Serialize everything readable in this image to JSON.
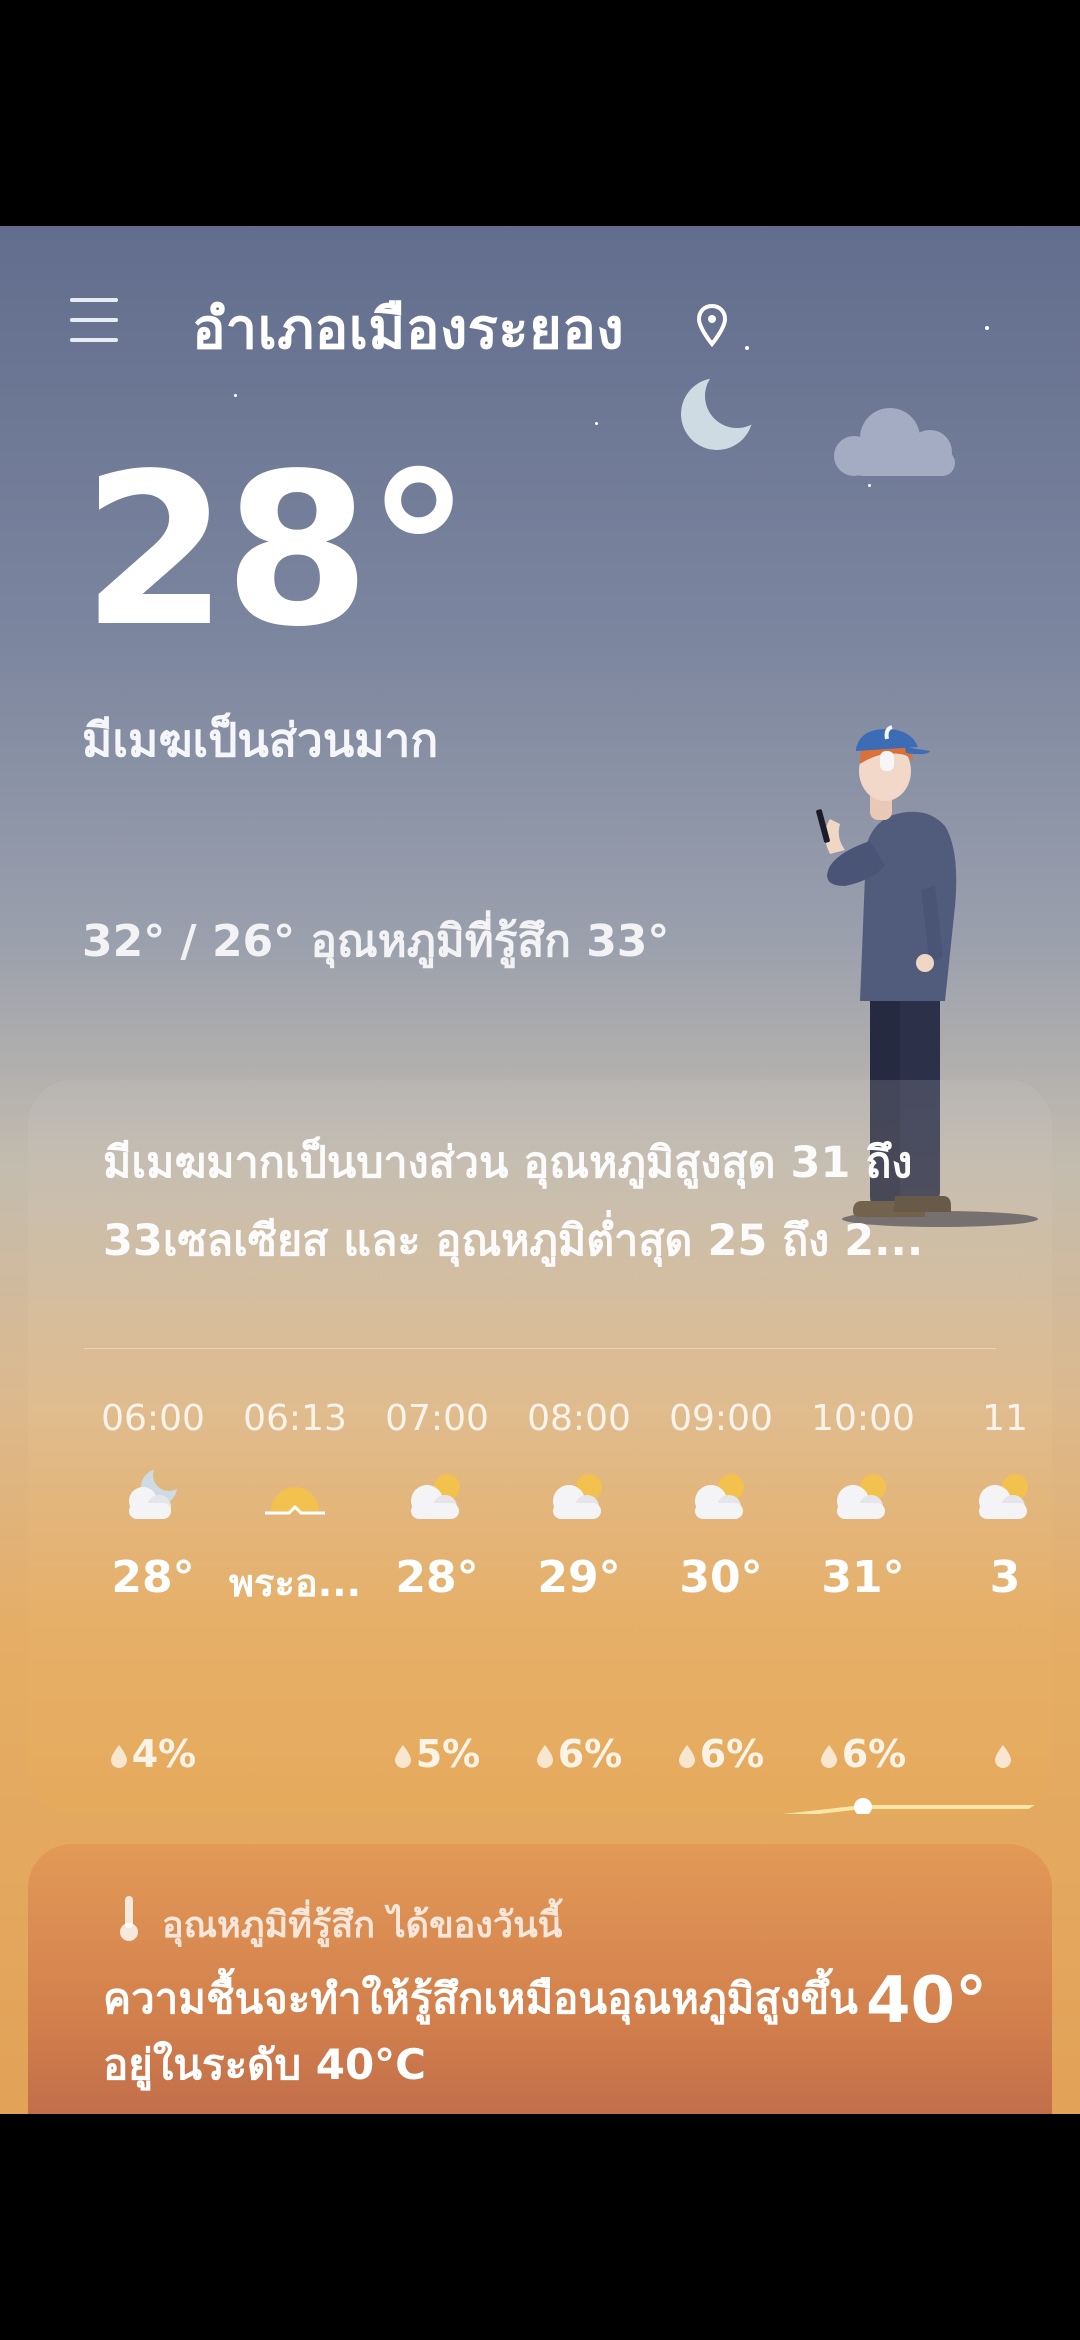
{
  "header": {
    "location": "อำเภอเมืองระยอง",
    "menu_icon": "hamburger-menu-icon",
    "pin_icon": "location-pin-icon"
  },
  "current": {
    "temperature": "28°",
    "condition": "มีเมฆเป็นส่วนมาก",
    "hi_lo_feels": "32° / 26° อุณหภูมิที่รู้สึก 33°"
  },
  "forecast_summary": "มีเมฆมากเป็นบางส่วน อุณหภูมิสูงสุด 31 ถึง 33เซลเซียส และ อุณหภูมิต่ำสุด 25 ถึง 2...",
  "hourly": [
    {
      "time": "06:00",
      "icon": "moon-cloud-icon",
      "temp": "28°",
      "rain": "4%"
    },
    {
      "time": "06:13",
      "icon": "sunrise-icon",
      "temp": "พระอ...",
      "rain": ""
    },
    {
      "time": "07:00",
      "icon": "sun-cloud-icon",
      "temp": "28°",
      "rain": "5%"
    },
    {
      "time": "08:00",
      "icon": "sun-cloud-icon",
      "temp": "29°",
      "rain": "6%"
    },
    {
      "time": "09:00",
      "icon": "sun-cloud-icon",
      "temp": "30°",
      "rain": "6%"
    },
    {
      "time": "10:00",
      "icon": "sun-cloud-icon",
      "temp": "31°",
      "rain": "6%"
    },
    {
      "time": "11",
      "icon": "sun-cloud-icon",
      "temp": "3",
      "rain": ""
    }
  ],
  "feels_like": {
    "label": "อุณหภูมิที่รู้สึก ได้ของวันนี้",
    "description": "ความชื้นจะทำให้รู้สึกเหมือนอุณหภูมิสูงขึ้นอยู่ในระดับ 40°C",
    "value": "40°",
    "icon": "thermometer-icon"
  },
  "colors": {
    "sky_top": "#626d8d",
    "sky_bottom": "#e2a257",
    "trend_line": "#f7e6a6",
    "feels_card": "#d27f4c"
  }
}
